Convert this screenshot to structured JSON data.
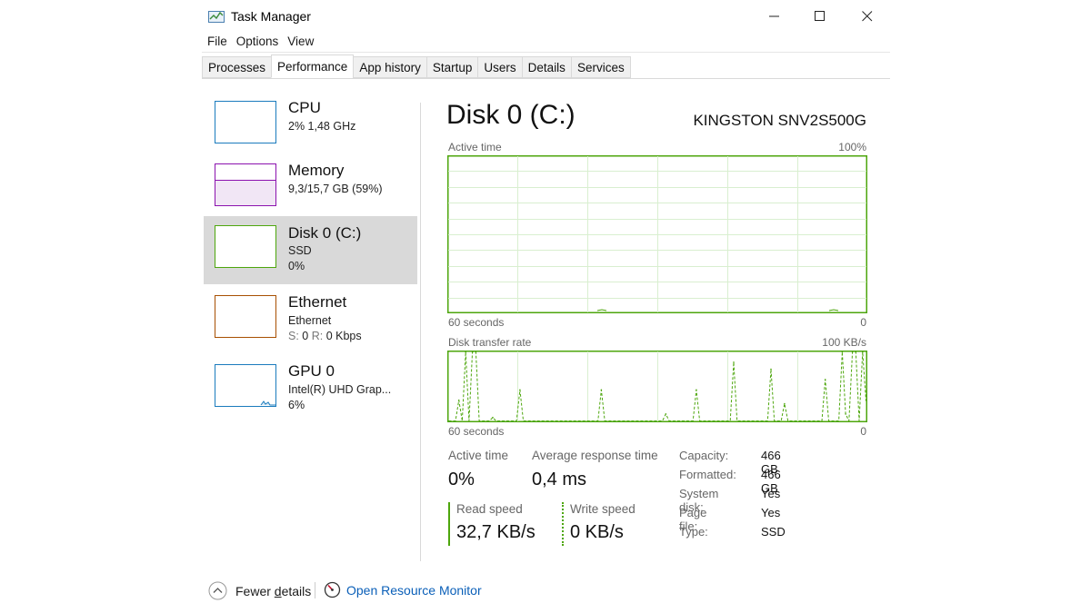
{
  "window": {
    "title": "Task Manager",
    "icon": "task-manager-icon",
    "controls": {
      "minimize": "minimize-icon",
      "maximize": "maximize-icon",
      "close": "close-icon"
    }
  },
  "menu": [
    "File",
    "Options",
    "View"
  ],
  "tabs": [
    "Processes",
    "Performance",
    "App history",
    "Startup",
    "Users",
    "Details",
    "Services"
  ],
  "active_tab": "Performance",
  "sidebar": {
    "items": [
      {
        "title": "CPU",
        "line1": "2% 1,48 GHz",
        "line2": "",
        "color": "#1a7bbd"
      },
      {
        "title": "Memory",
        "line1": "9,3/15,7 GB (59%)",
        "line2": "",
        "color": "#8b12ae"
      },
      {
        "title": "Disk 0 (C:)",
        "line1": "SSD",
        "line2": "0%",
        "color": "#4da60c"
      },
      {
        "title": "Ethernet",
        "line1": "Ethernet",
        "line2_s": "S:",
        "line2_sv": "0",
        "line2_r": "R:",
        "line2_rv": "0 Kbps",
        "color": "#a74f01"
      },
      {
        "title": "GPU 0",
        "line1": "Intel(R) UHD Grap...",
        "line2": "6%",
        "color": "#1a7bbd"
      }
    ],
    "selected_index": 2
  },
  "main": {
    "title": "Disk 0 (C:)",
    "model": "KINGSTON SNV2S500G",
    "graph1": {
      "label": "Active time",
      "max": "100%",
      "time": "60 seconds",
      "min": "0"
    },
    "graph2": {
      "label": "Disk transfer rate",
      "max": "100 KB/s",
      "time": "60 seconds",
      "min": "0"
    },
    "stats": {
      "active_time_label": "Active time",
      "active_time_value": "0%",
      "avg_response_label": "Average response time",
      "avg_response_value": "0,4 ms",
      "read_label": "Read speed",
      "read_value": "32,7 KB/s",
      "write_label": "Write speed",
      "write_value": "0 KB/s"
    },
    "properties": [
      {
        "label": "Capacity:",
        "value": "466 GB"
      },
      {
        "label": "Formatted:",
        "value": "466 GB"
      },
      {
        "label": "System disk:",
        "value": "Yes"
      },
      {
        "label": "Page file:",
        "value": "Yes"
      },
      {
        "label": "Type:",
        "value": "SSD"
      }
    ]
  },
  "footer": {
    "fewer_details_prefix": "Fewer ",
    "fewer_details_underlined": "d",
    "fewer_details_suffix": "etails",
    "resource_monitor": "Open Resource Monitor"
  },
  "chart_data": {
    "type": "line",
    "title": "Disk transfer rate",
    "xlabel": "60 seconds",
    "ylim": [
      0,
      100
    ],
    "series": [
      {
        "values": [
          0,
          0,
          0,
          30,
          0,
          100,
          0,
          100,
          100,
          0,
          0,
          0,
          0,
          5,
          0,
          0,
          0,
          0,
          0,
          0,
          0,
          45,
          0,
          0,
          0,
          0,
          0,
          0,
          0,
          0,
          0,
          0,
          0,
          0,
          0,
          0,
          0,
          0,
          0,
          0,
          0,
          0,
          0,
          0,
          0,
          45,
          0,
          0,
          0,
          0,
          0,
          0,
          0,
          0,
          0,
          0,
          0,
          0,
          0,
          0,
          0,
          0,
          0,
          0,
          10,
          0,
          0,
          0,
          0,
          0,
          0,
          0,
          0,
          45,
          0,
          0,
          0,
          0,
          0,
          0,
          0,
          0,
          0,
          0,
          85,
          0,
          0,
          0,
          0,
          0,
          0,
          0,
          0,
          0,
          0,
          75,
          0,
          0,
          0,
          25,
          0,
          0,
          0,
          0,
          0,
          0,
          0,
          0,
          0,
          0,
          0,
          60,
          0,
          0,
          0,
          0,
          100,
          10,
          0,
          100,
          100,
          0,
          100,
          30
        ]
      }
    ]
  }
}
